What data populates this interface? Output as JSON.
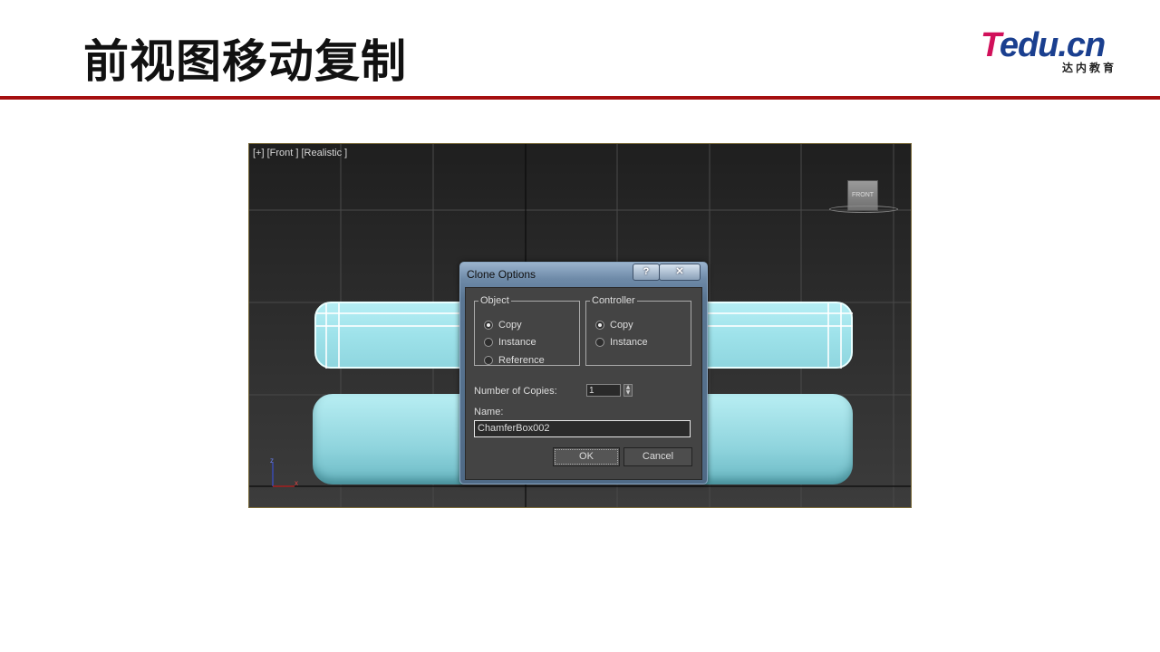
{
  "slide": {
    "title": "前视图移动复制",
    "logo_main_accent": "T",
    "logo_main_rest": "edu.cn",
    "logo_sub": "达内教育"
  },
  "viewport": {
    "label": "[+] [Front ] [Realistic ]",
    "viewcube_label": "FRONT",
    "axis_z": "z",
    "axis_x": "x"
  },
  "dialog": {
    "title": "Clone Options",
    "help_button": "?",
    "close_button": "✕",
    "object_group": {
      "legend": "Object",
      "options": [
        "Copy",
        "Instance",
        "Reference"
      ],
      "selected": "Copy"
    },
    "controller_group": {
      "legend": "Controller",
      "options": [
        "Copy",
        "Instance"
      ],
      "selected": "Copy"
    },
    "copies_label": "Number of Copies:",
    "copies_value": "1",
    "name_label": "Name:",
    "name_value": "ChamferBox002",
    "ok_label": "OK",
    "cancel_label": "Cancel"
  },
  "colors": {
    "accent_rule": "#a50f10",
    "logo_pink": "#d1105a",
    "logo_blue": "#1a3f8f",
    "cushion": "#a8e6ee"
  }
}
